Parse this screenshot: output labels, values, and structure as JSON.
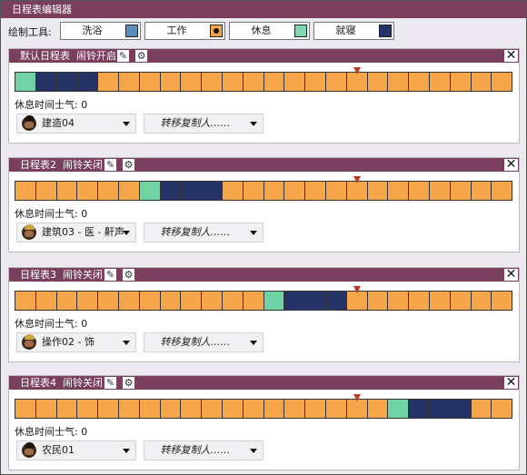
{
  "window": {
    "title": "日程表编辑器"
  },
  "toolbar": {
    "label": "绘制工具:",
    "tools": [
      {
        "name": "洗浴",
        "color": "#5b8db8",
        "selected": false
      },
      {
        "name": "工作",
        "color": "#f6a64a",
        "selected": true
      },
      {
        "name": "休息",
        "color": "#7fd6b1",
        "selected": false
      },
      {
        "name": "就寝",
        "color": "#263366",
        "selected": false
      }
    ]
  },
  "colors": {
    "bath": "#5b8db8",
    "work": "#f6a64a",
    "recreation": "#6fd3a6",
    "sleep": "#263366",
    "header": "#7a3f5c",
    "marker": "#c0392b"
  },
  "schedules": [
    {
      "name": "默认日程表",
      "alarm": "闹铃开启",
      "morale_label": "休息时间士气: 0",
      "dupe": "建造04",
      "transfer_label": "转移复制人……",
      "marker_slot": 16.5,
      "blocks": [
        "recreation",
        "sleep",
        "sleep",
        "sleep",
        "work",
        "work",
        "work",
        "work",
        "work",
        "work",
        "work",
        "work",
        "work",
        "work",
        "work",
        "work",
        "work",
        "work",
        "work",
        "work",
        "work",
        "work",
        "work",
        "work"
      ]
    },
    {
      "name": "日程表2",
      "alarm": "闹铃关闭",
      "morale_label": "休息时间士气: 0",
      "dupe": "建筑03 - 医 - 鼾声",
      "transfer_label": "转移复制人……",
      "marker_slot": 16.5,
      "blocks": [
        "work",
        "work",
        "work",
        "work",
        "work",
        "work",
        "recreation",
        "sleep",
        "sleep",
        "sleep",
        "work",
        "work",
        "work",
        "work",
        "work",
        "work",
        "work",
        "work",
        "work",
        "work",
        "work",
        "work",
        "work",
        "work"
      ]
    },
    {
      "name": "日程表3",
      "alarm": "闹铃关闭",
      "morale_label": "休息时间士气: 0",
      "dupe": "操作02 - 饰",
      "transfer_label": "转移复制人……",
      "marker_slot": 16.5,
      "blocks": [
        "work",
        "work",
        "work",
        "work",
        "work",
        "work",
        "work",
        "work",
        "work",
        "work",
        "work",
        "work",
        "recreation",
        "sleep",
        "sleep",
        "sleep",
        "work",
        "work",
        "work",
        "work",
        "work",
        "work",
        "work",
        "work"
      ]
    },
    {
      "name": "日程表4",
      "alarm": "闹铃关闭",
      "morale_label": "休息时间士气: 0",
      "dupe": "农民01",
      "transfer_label": "转移复制人……",
      "marker_slot": 16.5,
      "blocks": [
        "work",
        "work",
        "work",
        "work",
        "work",
        "work",
        "work",
        "work",
        "work",
        "work",
        "work",
        "work",
        "work",
        "work",
        "work",
        "work",
        "work",
        "work",
        "recreation",
        "sleep",
        "sleep",
        "sleep",
        "work",
        "work"
      ]
    }
  ],
  "icons": {
    "edit": "pencil-icon",
    "settings": "gear-icon",
    "close": "close-icon"
  }
}
